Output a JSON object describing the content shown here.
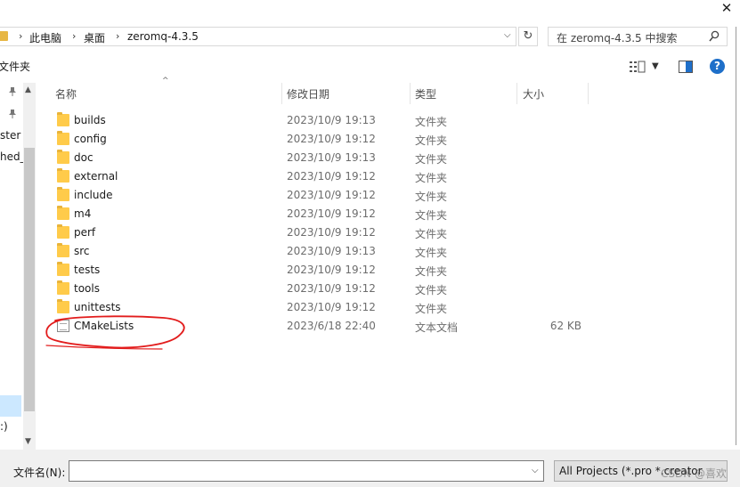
{
  "window": {
    "close_glyph": "✕"
  },
  "address_bar": {
    "crumbs": [
      "此电脑",
      "桌面",
      "zeromq-4.3.5"
    ],
    "separator": "›",
    "dropdown_glyph": "⌵",
    "refresh_glyph": "↻"
  },
  "search": {
    "placeholder": "在 zeromq-4.3.5 中搜索"
  },
  "toolbar": {
    "new_folder_label": "文件夹"
  },
  "nav": {
    "labels": [
      "ster",
      "hed_",
      ":)"
    ]
  },
  "columns": {
    "name": "名称",
    "date": "修改日期",
    "type": "类型",
    "size": "大小"
  },
  "files": [
    {
      "name": "builds",
      "date": "2023/10/9 19:13",
      "type": "文件夹",
      "size": "",
      "kind": "folder"
    },
    {
      "name": "config",
      "date": "2023/10/9 19:12",
      "type": "文件夹",
      "size": "",
      "kind": "folder"
    },
    {
      "name": "doc",
      "date": "2023/10/9 19:13",
      "type": "文件夹",
      "size": "",
      "kind": "folder"
    },
    {
      "name": "external",
      "date": "2023/10/9 19:12",
      "type": "文件夹",
      "size": "",
      "kind": "folder"
    },
    {
      "name": "include",
      "date": "2023/10/9 19:12",
      "type": "文件夹",
      "size": "",
      "kind": "folder"
    },
    {
      "name": "m4",
      "date": "2023/10/9 19:12",
      "type": "文件夹",
      "size": "",
      "kind": "folder"
    },
    {
      "name": "perf",
      "date": "2023/10/9 19:12",
      "type": "文件夹",
      "size": "",
      "kind": "folder"
    },
    {
      "name": "src",
      "date": "2023/10/9 19:13",
      "type": "文件夹",
      "size": "",
      "kind": "folder"
    },
    {
      "name": "tests",
      "date": "2023/10/9 19:12",
      "type": "文件夹",
      "size": "",
      "kind": "folder"
    },
    {
      "name": "tools",
      "date": "2023/10/9 19:12",
      "type": "文件夹",
      "size": "",
      "kind": "folder"
    },
    {
      "name": "unittests",
      "date": "2023/10/9 19:12",
      "type": "文件夹",
      "size": "",
      "kind": "folder"
    },
    {
      "name": "CMakeLists",
      "date": "2023/6/18 22:40",
      "type": "文本文档",
      "size": "62 KB",
      "kind": "document"
    }
  ],
  "annotation": {
    "color": "#e21c1c",
    "target": "CMakeLists"
  },
  "bottom": {
    "filename_label": "文件名(N):",
    "filename_value": "",
    "filter_label": "All Projects (*.pro *.creator",
    "watermark": "CSDN @喜欢"
  },
  "colors": {
    "accent": "#1e6fc9",
    "folder": "#ffcb4a",
    "selection": "#cce8ff"
  }
}
